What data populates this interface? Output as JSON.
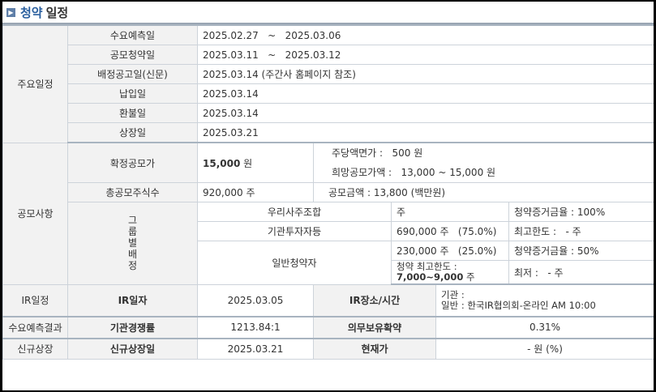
{
  "title": {
    "highlight": "청약",
    "rest": "일정"
  },
  "schedule": {
    "section": "주요일정",
    "rows": [
      {
        "label": "수요예측일",
        "value": "2025.02.27   ~   2025.03.06"
      },
      {
        "label": "공모청약일",
        "value": "2025.03.11   ~   2025.03.12"
      },
      {
        "label": "배정공고일(신문)",
        "value": "2025.03.14 (주간사 홈페이지 참조)"
      },
      {
        "label": "납입일",
        "value": "2025.03.14"
      },
      {
        "label": "환불일",
        "value": "2025.03.14"
      },
      {
        "label": "상장일",
        "value": "2025.03.21"
      }
    ]
  },
  "offering": {
    "section": "공모사항",
    "final_price_label": "확정공모가",
    "final_price_num": "15,000",
    "final_price_unit": " 원",
    "par_value": "주당액면가 :   500 원",
    "hope_price": "희망공모가액 :   13,000 ~ 15,000 원",
    "total_shares_label": "총공모주식수",
    "total_shares": "920,000 주",
    "total_amount": "공모금액 : 13,800 (백만원)",
    "group_label": [
      "그",
      "룹",
      "별",
      "배",
      "정"
    ],
    "employees": {
      "label": "우리사주조합",
      "shares": "주",
      "note": "청약증거금율 : 100%"
    },
    "institutions": {
      "label": "기관투자자등",
      "shares": "690,000 주   (75.0%)",
      "note": "최고한도 :   - 주"
    },
    "retail": {
      "label": "일반청약자",
      "shares": "230,000 주   (25.0%)",
      "note": "청약증거금율 : 50%",
      "limit_label": "청약 최고한도 :",
      "limit_value": "7,000~9,000",
      "limit_unit": " 주",
      "min": "최저 :   - 주"
    }
  },
  "ir": {
    "section": "IR일정",
    "date_label": "IR일자",
    "date": "2025.03.05",
    "place_label": "IR장소/시간",
    "place_line1": "기관 :",
    "place_line2": "일반 : 한국IR협의회-온라인 AM 10:00"
  },
  "demand": {
    "section": "수요예측결과",
    "rate_label": "기관경쟁률",
    "rate": "1213.84:1",
    "lockup_label": "의무보유확약",
    "lockup": "0.31%"
  },
  "listing": {
    "section": "신규상장",
    "date_label": "신규상장일",
    "date": "2025.03.21",
    "price_label": "현재가",
    "price": "- 원 (%)"
  }
}
